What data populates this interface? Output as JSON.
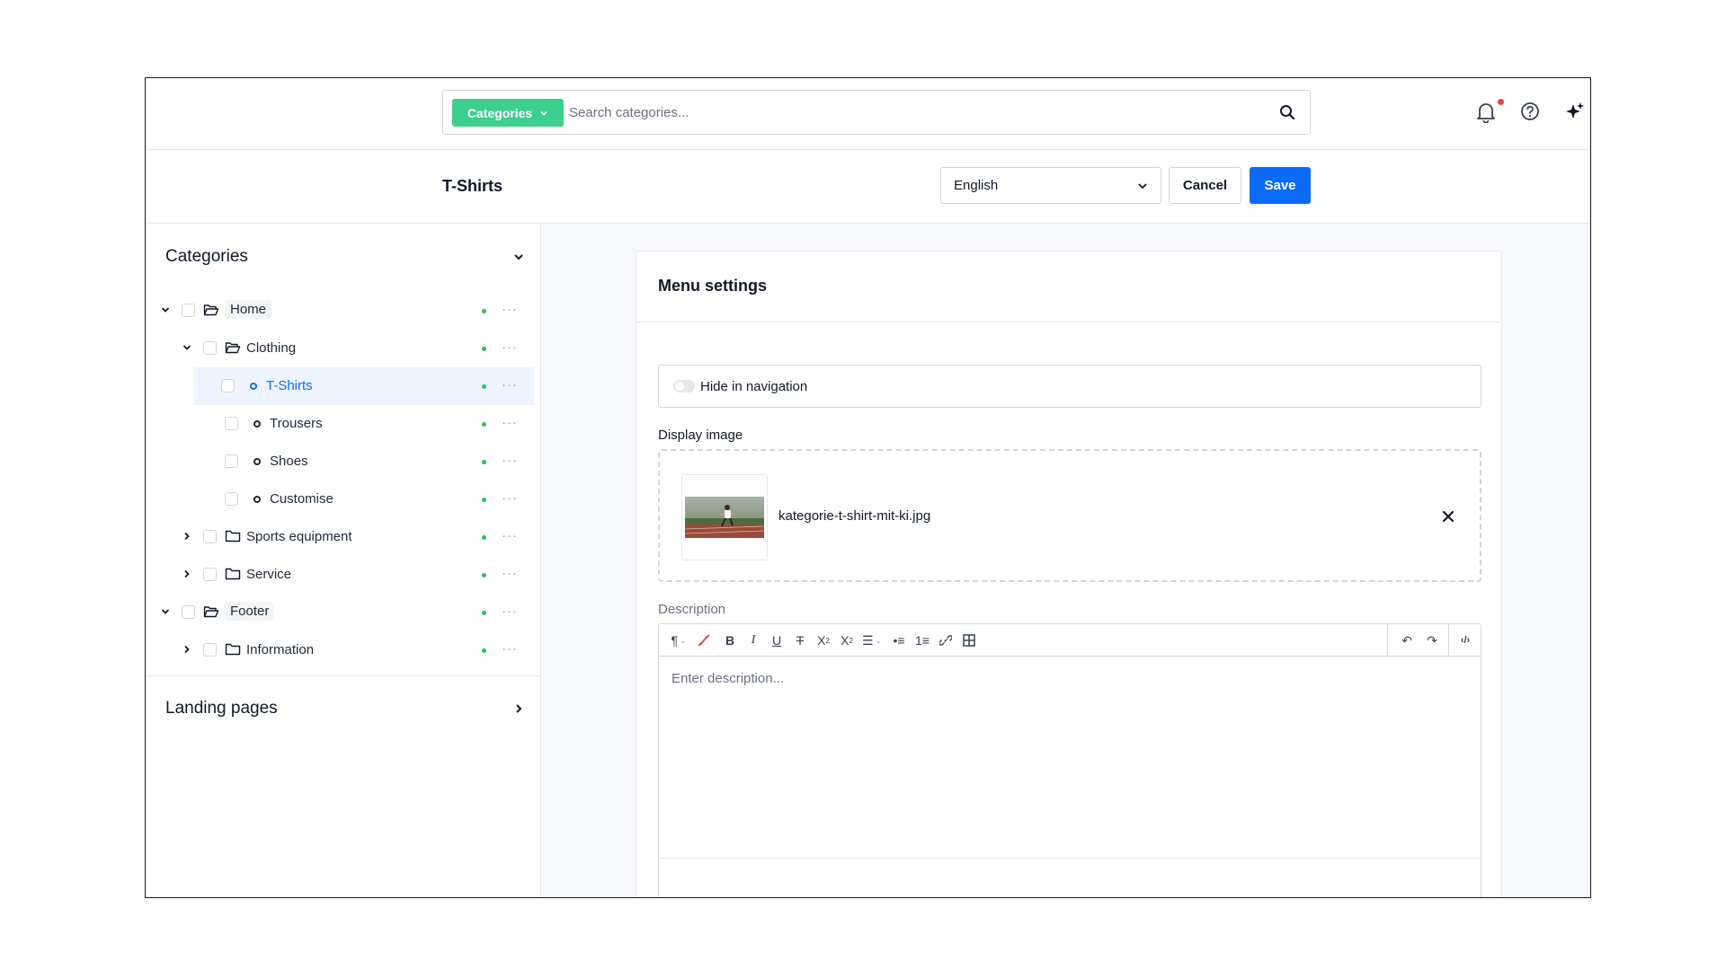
{
  "topbar": {
    "category_button": "Categories",
    "search_placeholder": "Search categories..."
  },
  "header": {
    "title": "T-Shirts",
    "language": "English",
    "cancel_label": "Cancel",
    "save_label": "Save"
  },
  "sidebar": {
    "categories_title": "Categories",
    "tree": [
      {
        "label": "Home"
      },
      {
        "label": "Clothing"
      },
      {
        "label": "T-Shirts"
      },
      {
        "label": "Trousers"
      },
      {
        "label": "Shoes"
      },
      {
        "label": "Customise"
      },
      {
        "label": "Sports equipment"
      },
      {
        "label": "Service"
      },
      {
        "label": "Footer"
      },
      {
        "label": "Information"
      }
    ],
    "landing_pages_title": "Landing pages"
  },
  "main": {
    "card_title": "Menu settings",
    "hide_nav_label": "Hide in navigation",
    "display_image_label": "Display image",
    "file_name": "kategorie-t-shirt-mit-ki.jpg",
    "description_label": "Description",
    "description_placeholder": "Enter description..."
  },
  "colors": {
    "accent_green": "#3dcf8e",
    "primary_blue": "#0b6bf4",
    "status_green": "#22c55e",
    "notification_red": "#ef4444"
  }
}
